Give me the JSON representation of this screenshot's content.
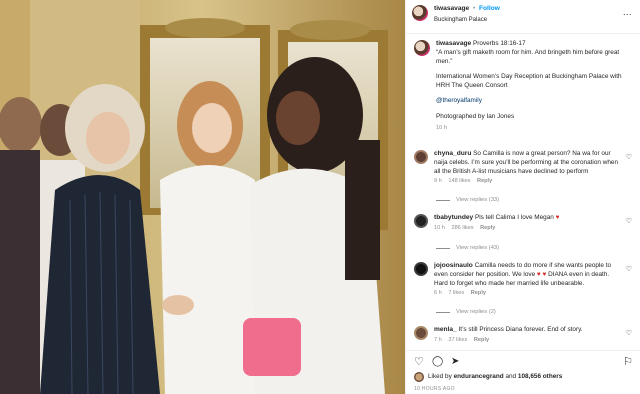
{
  "post": {
    "username": "tiwasavage",
    "separator": "•",
    "follow_label": "Follow",
    "location": "Buckingham Palace",
    "more_label": "...",
    "caption": {
      "username": "tiwasavage",
      "line1": "Proverbs 18:16-17",
      "line2": "“A man’s gift maketh room for him. And bringeth him before great men.”",
      "line3": "International Women’s Day Reception at Buckingham Palace with HRH The Queen Consort",
      "mention": "@theroyalfamily",
      "credit": "Photographed by Ian Jones",
      "time": "10 h"
    }
  },
  "comments": [
    {
      "username": "chyna_duru",
      "text": "So Camilla is now a great person? Na wa for our naija celebs. I’m sure you’ll be performing at the coronation when all the British A-list musicians have declined to perform",
      "time": "9 h",
      "likes": "148 likes",
      "reply": "Reply",
      "view_replies": "View replies (33)"
    },
    {
      "username": "tbabytundey",
      "text": "Pls tell Calima I love Megan",
      "time": "10 h",
      "likes": "286 likes",
      "reply": "Reply",
      "view_replies": "View replies (43)"
    },
    {
      "username": "jojoosinaulo",
      "text": "Camilla needs to do more if she wants people to even consider her position. We love",
      "text2": "DIANA even in death. Hard to forget who made her married life unbearable.",
      "time": "6 h",
      "likes": "7 likes",
      "reply": "Reply",
      "view_replies": "View replies (2)"
    },
    {
      "username": "menla_",
      "text": "It’s still Princess Diana forever. End of story.",
      "time": "7 h",
      "likes": "37 likes",
      "reply": "Reply"
    }
  ],
  "footer": {
    "liked_prefix": "Liked by",
    "liked_user": "endurancegrand",
    "liked_and": "and",
    "liked_count": "108,656 others",
    "ago": "10 HOURS AGO"
  },
  "icons": {
    "heart": "♡",
    "comment": "◯",
    "share": "➤",
    "bookmark": "⚐",
    "red_heart": "♥"
  }
}
